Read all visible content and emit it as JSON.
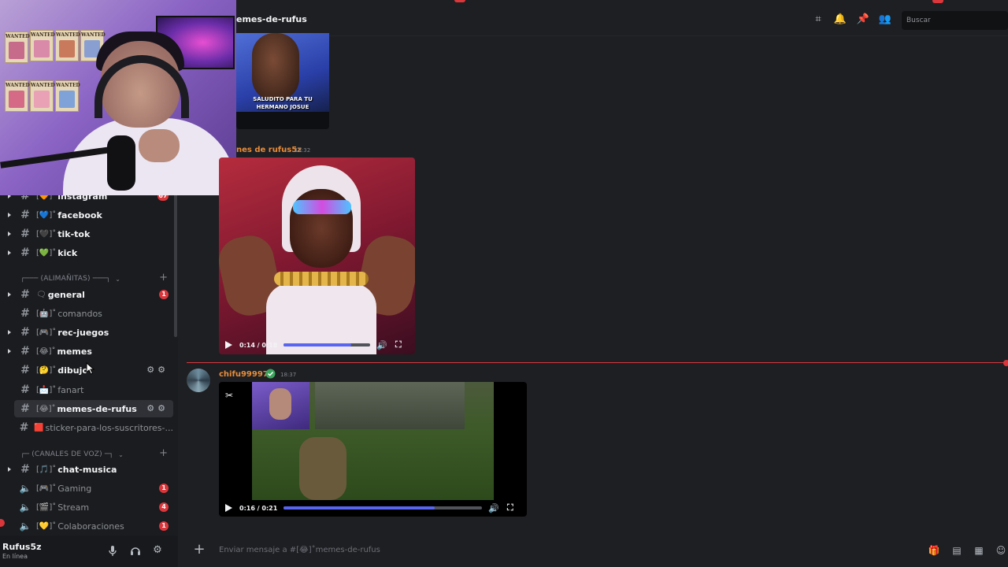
{
  "header": {
    "channel_title": "emes-de-rufus",
    "search_placeholder": "Buscar"
  },
  "sidebar": {
    "channels_top": [
      {
        "emoji": "🧡",
        "name": "instagram",
        "badge": "67",
        "bold": true
      },
      {
        "emoji": "💙",
        "name": "facebook",
        "bold": true
      },
      {
        "emoji": "🖤",
        "name": "tik-tok",
        "bold": true
      },
      {
        "emoji": "💚",
        "name": "kick",
        "bold": true
      }
    ],
    "category_1": "┌─── (ALIMAÑITAS) ───┐",
    "channels_mid": [
      {
        "emoji": "🗨",
        "name": "general",
        "badge": "1",
        "bold": true
      },
      {
        "emoji": "🤖",
        "name": "comandos",
        "bold": false
      },
      {
        "emoji": "🎮",
        "name": "rec-juegos",
        "bold": true
      },
      {
        "emoji": "😂",
        "name": "memes",
        "bold": true
      },
      {
        "emoji": "🤔",
        "name": "dibujo",
        "bold": true
      },
      {
        "emoji": "📩",
        "name": "fanart",
        "bold": false
      },
      {
        "emoji": "😂",
        "name": "memes-de-rufus",
        "bold": true,
        "active": true
      },
      {
        "emoji": "🟥",
        "name": "sticker-para-los-suscritores-...",
        "bold": false
      }
    ],
    "category_2": "┌─ (CANALES DE VOZ) ─┐",
    "channels_voice": [
      {
        "emoji": "🎵",
        "name": "chat-musica",
        "bold": true,
        "type": "text"
      },
      {
        "emoji": "🎮",
        "name": "Gaming",
        "badge": "1",
        "bold": false,
        "type": "voice"
      },
      {
        "emoji": "🎬",
        "name": "Stream",
        "badge": "4",
        "bold": false,
        "type": "voice"
      },
      {
        "emoji": "💛",
        "name": "Colaboraciones",
        "badge": "1",
        "bold": false,
        "type": "voice"
      }
    ],
    "prefix": "[",
    "suffix": "]˚"
  },
  "user": {
    "name": "Rufus5z",
    "status": "En línea"
  },
  "messages": [
    {
      "caption": "SALUDITO PARA TU HERMANO JOSUE"
    },
    {
      "author": "nes de rufus5z",
      "time": "18:32",
      "video_time": "0:14 / 0:18",
      "progress": 0.78
    },
    {
      "author": "chifu99997",
      "time": "18:37",
      "video_time": "0:16 / 0:21",
      "progress": 0.76
    }
  ],
  "composer": {
    "placeholder": "Enviar mensaje a #[😂]˚memes-de-rufus"
  },
  "colors": {
    "accent": "#5865f2",
    "mention_red": "#da373c",
    "username_orange": "#e88d3a",
    "online_green": "#3ba55d"
  }
}
